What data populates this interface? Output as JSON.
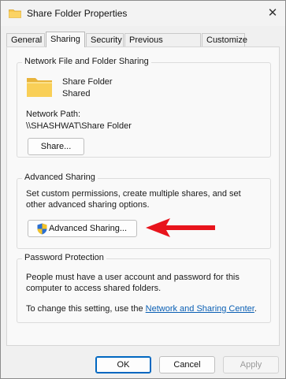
{
  "window": {
    "title": "Share Folder Properties",
    "close_glyph": "✕"
  },
  "tabs": [
    {
      "label": "General"
    },
    {
      "label": "Sharing",
      "active": true
    },
    {
      "label": "Security"
    },
    {
      "label": "Previous Versions"
    },
    {
      "label": "Customize"
    }
  ],
  "network_sharing": {
    "title": "Network File and Folder Sharing",
    "folder_name": "Share Folder",
    "folder_status": "Shared",
    "path_label": "Network Path:",
    "path_value": "\\\\SHASHWAT\\Share Folder",
    "share_button": "Share..."
  },
  "advanced_sharing": {
    "title": "Advanced Sharing",
    "description": "Set custom permissions, create multiple shares, and set other advanced sharing options.",
    "button": "Advanced Sharing..."
  },
  "password_protection": {
    "title": "Password Protection",
    "description": "People must have a user account and password for this computer to access shared folders.",
    "change_prefix": "To change this setting, use the ",
    "link": "Network and Sharing Center",
    "change_suffix": "."
  },
  "footer": {
    "ok": "OK",
    "cancel": "Cancel",
    "apply": "Apply"
  },
  "colors": {
    "accent": "#0067c0",
    "link": "#0a5fb4",
    "annotation_arrow": "#e8141c",
    "folder": "#f7c64b"
  },
  "icons": {
    "title": "folder-icon",
    "folder": "folder-icon",
    "uac": "uac-shield-icon",
    "annotation": "red-arrow-annotation"
  }
}
